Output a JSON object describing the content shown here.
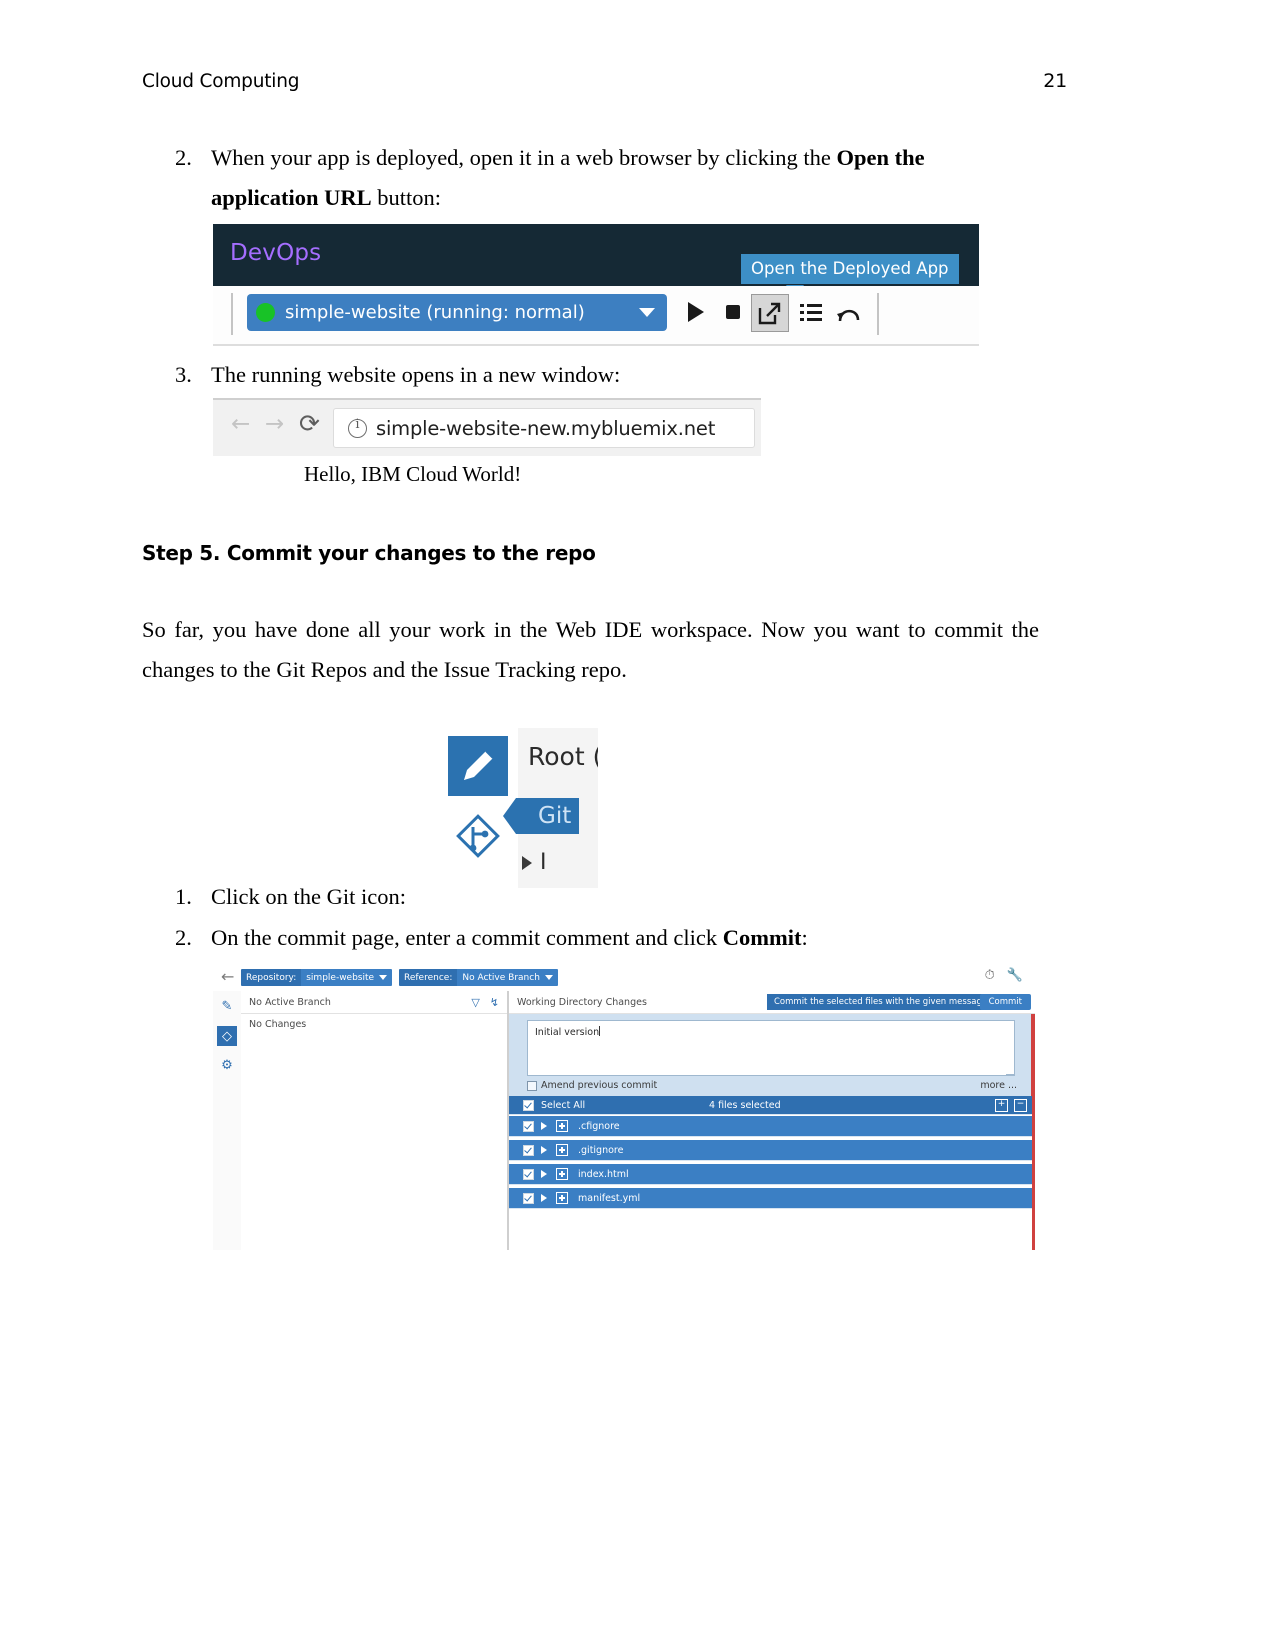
{
  "page_header": {
    "title": "Cloud Computing",
    "page_number": "21"
  },
  "steps_top": [
    {
      "num": "2.",
      "text_before": "When your app is deployed, open it in a web browser by clicking the ",
      "bold": "Open the application URL",
      "text_after": " button:"
    },
    {
      "num": "3.",
      "text": "The running website opens in a new window:"
    }
  ],
  "devops_screenshot": {
    "brand": "DevOps",
    "tooltip": "Open the Deployed App",
    "app_selector": "simple-website (running: normal)",
    "status_dot_color": "#18c227",
    "header_bg": "#152935",
    "accent": "#3d7fc1",
    "icons": [
      "play-icon",
      "stop-icon",
      "open-external-icon",
      "list-icon",
      "restart-icon"
    ]
  },
  "browser_screenshot": {
    "back_icon": "←",
    "forward_icon": "→",
    "reload_icon": "⟳",
    "url": "simple-website-new.mybluemix.net",
    "page_body_text": "Hello, IBM Cloud World!"
  },
  "section": {
    "heading": "Step 5. Commit your changes to the repo",
    "paragraph": "So far, you have done all your work in the Web IDE workspace. Now you want to commit the changes to the Git Repos and the Issue Tracking repo."
  },
  "git_screenshot": {
    "root_label": "Root (",
    "git_tooltip": "Git",
    "tree_item": "I",
    "tile_color": "#2b72b0"
  },
  "steps_bottom": [
    {
      "num": "1.",
      "text": "Click on the Git icon:"
    },
    {
      "num": "2.",
      "text_before": "On the commit page, enter a commit comment and click ",
      "bold": "Commit",
      "text_after": ":"
    }
  ],
  "ide_screenshot": {
    "breadcrumbs": [
      {
        "key": "Repository:",
        "value": "simple-website"
      },
      {
        "key": "Reference:",
        "value": "No Active Branch"
      }
    ],
    "top_right_icons": [
      "history-icon",
      "wrench-icon"
    ],
    "rail_icons": [
      "pencil-icon",
      "git-icon",
      "settings-icon"
    ],
    "left_panel": {
      "header": "No Active Branch",
      "filter_icon": "funnel-icon",
      "branch_icon": "branch-icon",
      "body": "No Changes"
    },
    "right_panel": {
      "header": "Working Directory Changes",
      "commit_tooltip": "Commit the selected files with the given message.",
      "commit_button": "Commit",
      "message_value": "Initial version",
      "amend_label": "Amend previous commit",
      "more_label": "more ...",
      "select_all_label": "Select All",
      "files_selected_label": "4 files selected",
      "expand_icon": "expand-all-icon",
      "collapse_icon": "collapse-all-icon",
      "files": [
        {
          "name": ".cfignore"
        },
        {
          "name": ".gitignore"
        },
        {
          "name": "index.html"
        },
        {
          "name": "manifest.yml"
        }
      ]
    }
  }
}
